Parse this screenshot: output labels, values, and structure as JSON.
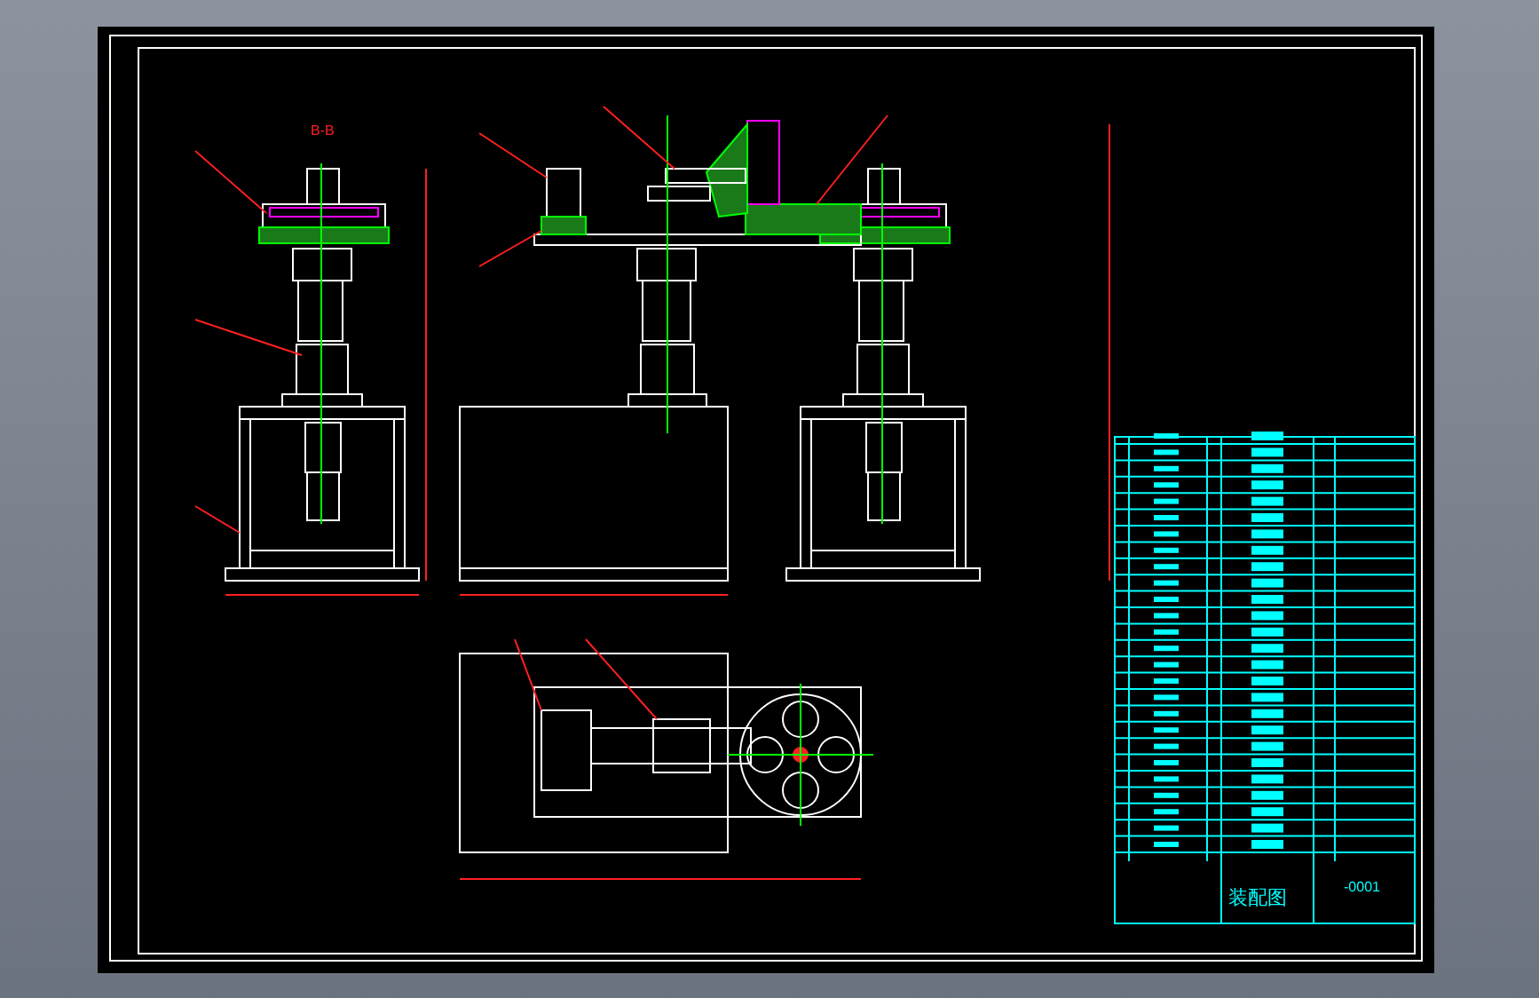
{
  "sheet": {
    "section_label": "B-B",
    "title": "装配图",
    "drawing_number": "-0001"
  }
}
